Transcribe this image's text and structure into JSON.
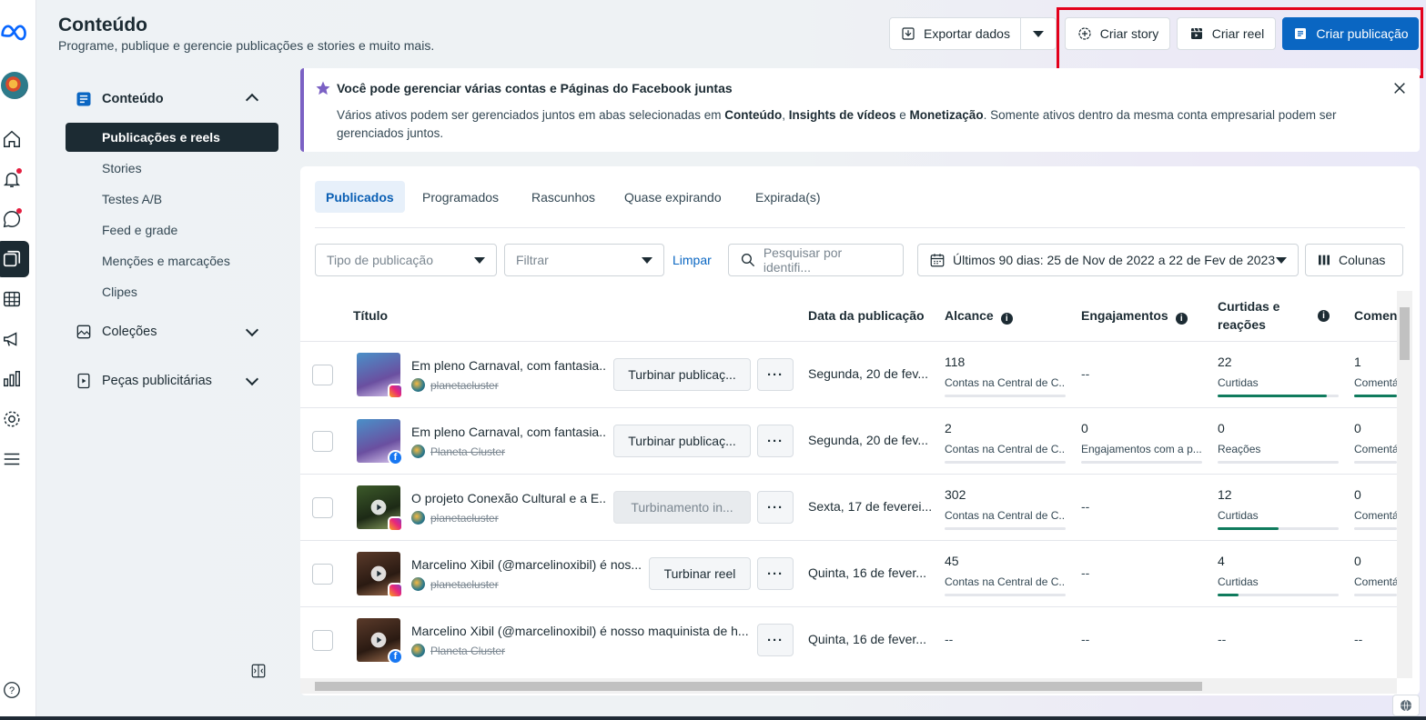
{
  "header": {
    "title": "Conteúdo",
    "subtitle": "Programe, publique e gerencie publicações e stories e muito mais.",
    "export_label": "Exportar dados",
    "create_story_label": "Criar story",
    "create_reel_label": "Criar reel",
    "create_post_label": "Criar publicação"
  },
  "sidebar": {
    "section_content": "Conteúdo",
    "items": [
      "Publicações e reels",
      "Stories",
      "Testes A/B",
      "Feed e grade",
      "Menções e marcações",
      "Clipes"
    ],
    "section_collections": "Coleções",
    "section_ads": "Peças publicitárias"
  },
  "banner": {
    "title": "Você pode gerenciar várias contas e Páginas do Facebook juntas",
    "body_1": "Vários ativos podem ser gerenciados juntos em abas selecionadas em ",
    "b1": "Conteúdo",
    "sep1": ", ",
    "b2": "Insights de vídeos",
    "sep2": " e ",
    "b3": "Monetização",
    "body_2": ". Somente ativos dentro da mesma conta empresarial podem ser gerenciados juntos."
  },
  "tabs": [
    "Publicados",
    "Programados",
    "Rascunhos",
    "Quase expirando",
    "Expirada(s)"
  ],
  "filters": {
    "type_placeholder": "Tipo de publicação",
    "filter_placeholder": "Filtrar",
    "clear_label": "Limpar",
    "search_placeholder": "Pesquisar por identifi...",
    "date_range": "Últimos 90 dias: 25 de Nov de 2022 a 22 de Fev de 2023",
    "columns_label": "Colunas"
  },
  "table": {
    "headers": {
      "title": "Título",
      "date": "Data da publicação",
      "reach": "Alcance",
      "engagement": "Engajamentos",
      "likes_1": "Curtidas e",
      "likes_2": "reações",
      "comments": "Comen"
    },
    "rows": [
      {
        "title": "Em pleno Carnaval, com fantasia...",
        "account": "planetacluster",
        "network": "instagram",
        "boost": "Turbinar publicaç...",
        "date": "Segunda, 20 de fev...",
        "reach": "118",
        "reach_label": "Contas na Central de C...",
        "reach_pct": 0,
        "eng": "--",
        "eng_label": "",
        "likes": "22",
        "likes_label": "Curtidas",
        "likes_pct": 0.9,
        "comments": "1",
        "comments_label": "Comentá",
        "comments_pct": 1
      },
      {
        "title": "Em pleno Carnaval, com fantasia...",
        "account": "Planeta Cluster",
        "network": "facebook",
        "boost": "Turbinar publicaç...",
        "date": "Segunda, 20 de fev...",
        "reach": "2",
        "reach_label": "Contas na Central de C...",
        "reach_pct": 0,
        "eng": "0",
        "eng_label": "Engajamentos com a p...",
        "likes": "0",
        "likes_label": "Reações",
        "likes_pct": 0,
        "comments": "0",
        "comments_label": "Comentá",
        "comments_pct": 0
      },
      {
        "title": "O projeto Conexão Cultural e a E...",
        "account": "planetacluster",
        "network": "instagram",
        "boost": "Turbinamento in...",
        "date": "Sexta, 17 de feverei...",
        "reach": "302",
        "reach_label": "Contas na Central de C...",
        "reach_pct": 0,
        "eng": "--",
        "eng_label": "",
        "likes": "12",
        "likes_label": "Curtidas",
        "likes_pct": 0.5,
        "comments": "0",
        "comments_label": "Comentá",
        "comments_pct": 0
      },
      {
        "title": "Marcelino Xibil (@marcelinoxibil) é nos...",
        "account": "planetacluster",
        "network": "instagram",
        "boost": "Turbinar reel",
        "date": "Quinta, 16 de fever...",
        "reach": "45",
        "reach_label": "Contas na Central de C...",
        "reach_pct": 0,
        "eng": "--",
        "eng_label": "",
        "likes": "4",
        "likes_label": "Curtidas",
        "likes_pct": 0.17,
        "comments": "0",
        "comments_label": "Comentá",
        "comments_pct": 0
      },
      {
        "title": "Marcelino Xibil (@marcelinoxibil) é nosso maquinista de h...",
        "account": "Planeta Cluster",
        "network": "facebook",
        "boost": "",
        "date": "Quinta, 16 de fever...",
        "reach": "--",
        "reach_label": "",
        "reach_pct": 0,
        "eng": "--",
        "eng_label": "",
        "likes": "--",
        "likes_label": "",
        "likes_pct": 0,
        "comments": "--",
        "comments_label": "",
        "comments_pct": 0
      }
    ]
  },
  "colors": {
    "accent": "#0a66c2",
    "highlight": "#e3001b",
    "progress": "#0f7b5d",
    "dark": "#1c2b33"
  }
}
